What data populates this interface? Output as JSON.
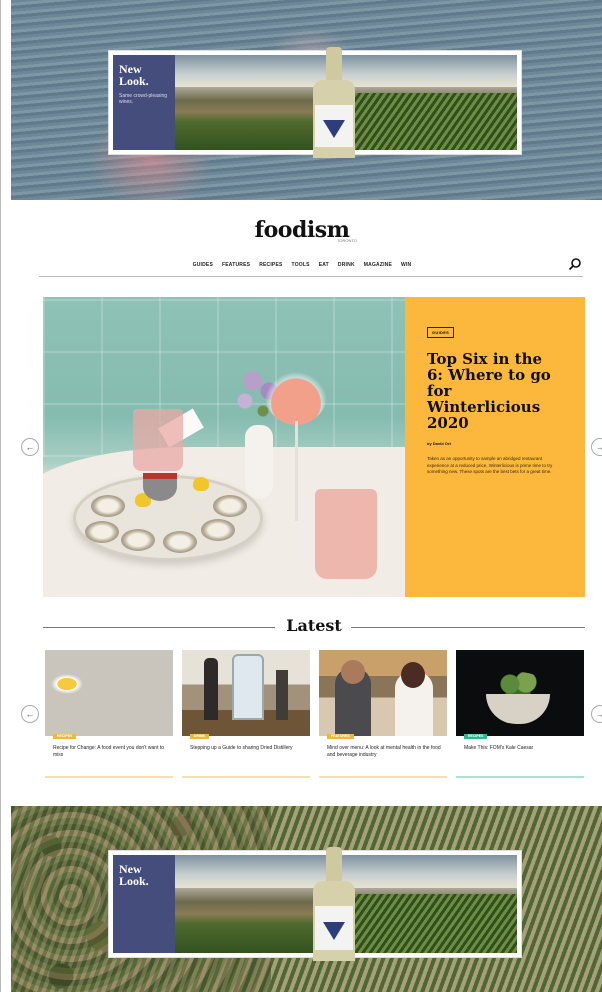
{
  "ads": {
    "top": {
      "brand_heading": "New Look.",
      "brand_sub": "Same crowd-pleasing wines."
    },
    "bottom": {
      "brand_heading": "New Look."
    }
  },
  "header": {
    "logo": "foodism",
    "logo_sub": "TORONTO",
    "nav": [
      "GUIDES",
      "FEATURES",
      "RECIPES",
      "TOOLS",
      "EAT",
      "DRINK",
      "MAGAZINE",
      "WIN"
    ]
  },
  "hero": {
    "tag": "GUIDES",
    "title": "Top Six in the 6: Where to go for Winterlicious 2020",
    "byline": "by David Ort",
    "excerpt": "Taken as an opportunity to sample an abridged restaurant experience at a reduced price, Winterlicious is prime time to try something new. These spots are the best bets for a great time."
  },
  "latest": {
    "heading": "Latest",
    "cards": [
      {
        "badge": "RECIPES",
        "title": "Recipe for Change: A food event you don't want to miss"
      },
      {
        "badge": "DRINK",
        "title": "Stepping up a Guide to sharing Dried Distillery"
      },
      {
        "badge": "FEATURES",
        "title": "Mind over menu: A look at mental health in the food and beverage industry"
      },
      {
        "badge": "RECIPES",
        "title": "Make This: FOM's Kale Caesar"
      }
    ]
  },
  "colors": {
    "hero_panel": "#fcb83c",
    "ad_brand": "#444d7c",
    "badge_orange": "#f1b63a",
    "badge_green": "#28b98e"
  }
}
